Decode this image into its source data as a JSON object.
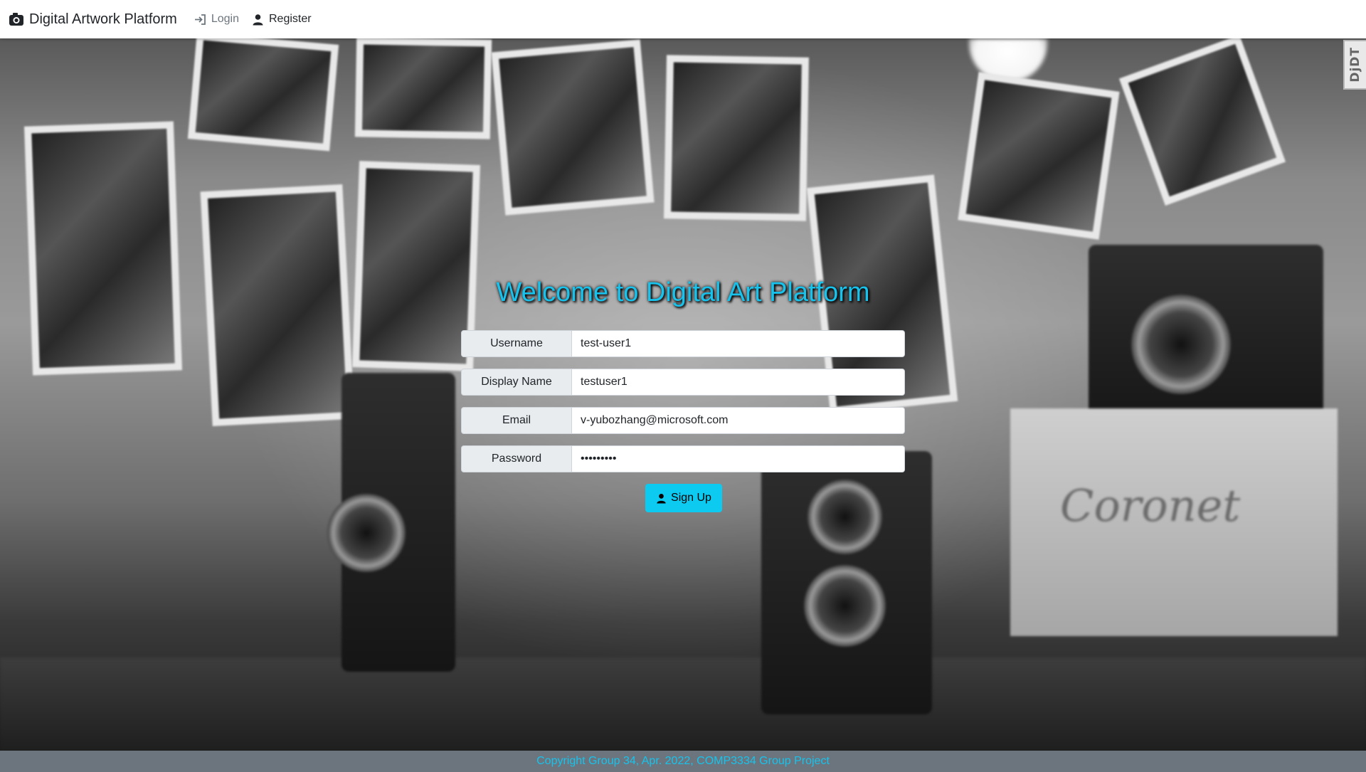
{
  "navbar": {
    "brand": "Digital Artwork Platform",
    "brand_icon": "camera-icon",
    "login": "Login",
    "login_icon": "sign-in-icon",
    "register": "Register",
    "register_icon": "person-icon"
  },
  "debug_toolbar": {
    "label": "DjDT"
  },
  "hero": {
    "background": "monochrome photo wall with vintage cameras",
    "box_label": "Coronet"
  },
  "form": {
    "title": "Welcome to Digital Art Platform",
    "fields": [
      {
        "label": "Username",
        "value": "test-user1",
        "type": "text"
      },
      {
        "label": "Display Name",
        "value": "testuser1",
        "type": "text"
      },
      {
        "label": "Email",
        "value": "v-yubozhang@microsoft.com",
        "type": "email"
      },
      {
        "label": "Password",
        "value": "testuser1",
        "type": "password"
      }
    ],
    "submit": "Sign Up",
    "submit_icon": "person-icon"
  },
  "footer": {
    "text": "Copyright Group 34, Apr. 2022, COMP3334 Group Project"
  },
  "colors": {
    "accent": "#17c3ec",
    "button": "#0dcaf0",
    "footer_bg": "#6c757d",
    "input_label_bg": "#e9ecef"
  }
}
